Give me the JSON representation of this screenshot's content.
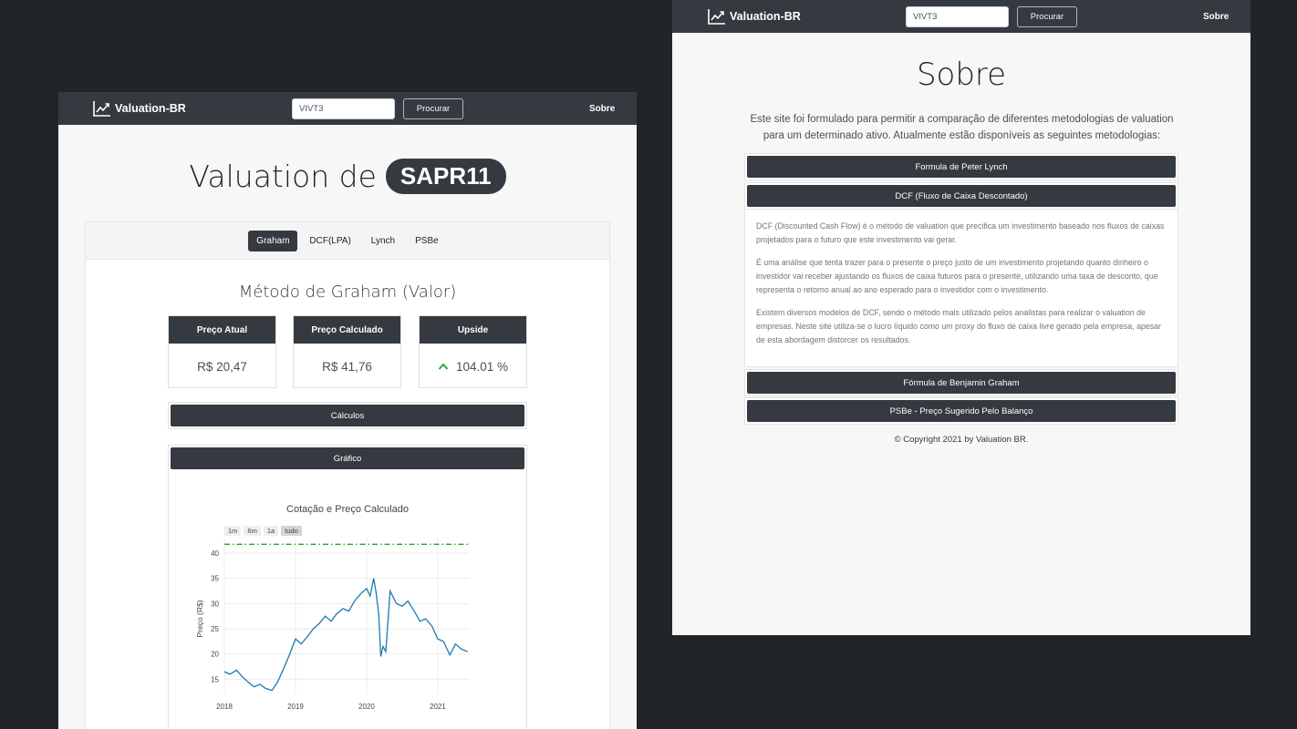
{
  "left": {
    "nav": {
      "brand": "Valuation-BR",
      "search_value": "VIVT3",
      "search_btn": "Procurar",
      "about_link": "Sobre"
    },
    "heading_prefix": "Valuation de",
    "ticker": "SAPR11",
    "tabs": [
      {
        "label": "Graham",
        "active": true
      },
      {
        "label": "DCF(LPA)",
        "active": false
      },
      {
        "label": "Lynch",
        "active": false
      },
      {
        "label": "PSBe",
        "active": false
      }
    ],
    "method_title": "Método de Graham (Valor)",
    "metrics": [
      {
        "label": "Preço Atual",
        "value": "R$ 20,47"
      },
      {
        "label": "Preço Calculado",
        "value": "R$ 41,76"
      },
      {
        "label": "Upside",
        "value": "104.01 %"
      }
    ],
    "calc_btn": "Cálculos",
    "chart_btn": "Gráfico",
    "range_buttons": [
      "1m",
      "6m",
      "1a",
      "tudo"
    ]
  },
  "chart_data": {
    "type": "line",
    "title": "Cotação e Preço Calculado",
    "xlabel": "",
    "ylabel": "Preço (R$)",
    "x_ticks": [
      "2018",
      "2019",
      "2020",
      "2021"
    ],
    "y_ticks": [
      15,
      20,
      25,
      30,
      35,
      40
    ],
    "ylim": [
      12,
      42
    ],
    "xlim": [
      2018.0,
      2021.45
    ],
    "grid": true,
    "series": [
      {
        "color": "#1f77b4",
        "style": "solid",
        "x": [
          2018.0,
          2018.08,
          2018.17,
          2018.25,
          2018.33,
          2018.42,
          2018.5,
          2018.58,
          2018.67,
          2018.75,
          2018.83,
          2018.92,
          2019.0,
          2019.08,
          2019.17,
          2019.25,
          2019.33,
          2019.42,
          2019.5,
          2019.58,
          2019.67,
          2019.75,
          2019.83,
          2019.92,
          2020.0,
          2020.05,
          2020.1,
          2020.13,
          2020.17,
          2020.2,
          2020.23,
          2020.27,
          2020.33,
          2020.42,
          2020.5,
          2020.58,
          2020.67,
          2020.75,
          2020.83,
          2020.92,
          2021.0,
          2021.08,
          2021.17,
          2021.25,
          2021.33,
          2021.42
        ],
        "y": [
          16.5,
          16.0,
          16.8,
          15.5,
          14.5,
          13.5,
          14.0,
          13.2,
          12.8,
          14.5,
          17.0,
          20.0,
          23.0,
          22.0,
          23.5,
          25.0,
          26.0,
          27.5,
          26.5,
          28.0,
          29.0,
          28.5,
          30.5,
          32.0,
          33.0,
          31.5,
          35.0,
          32.5,
          28.0,
          19.5,
          21.5,
          20.5,
          32.5,
          30.0,
          29.5,
          30.5,
          28.5,
          26.5,
          27.0,
          25.5,
          23.0,
          22.5,
          19.8,
          22.0,
          21.0,
          20.47
        ]
      },
      {
        "color": "#2ca02c",
        "style": "dashdot",
        "x": [
          2018.0,
          2021.45
        ],
        "y": [
          41.76,
          41.76
        ]
      }
    ]
  },
  "right": {
    "nav": {
      "brand": "Valuation-BR",
      "search_value": "VIVT3",
      "search_btn": "Procurar",
      "about_link": "Sobre"
    },
    "title": "Sobre",
    "intro": "Este site foi formulado para permitir a comparação de diferentes metodologias de valuation para um determinado ativo. Atualmente estão disponíveis as seguintes metodologias:",
    "accordion": {
      "lynch": "Formula de Peter Lynch",
      "dcf": "DCF (Fluxo de Caixa Descontado)",
      "dcf_p1": "DCF (Discounted Cash Flow) é o método de valuation que precifica um investimento baseado nos fluxos de caixas projetados para o futuro que este investimento vai gerar.",
      "dcf_p2": "É uma análise que tenta trazer para o presente o preço justo de um investimento projetando quanto dinheiro o investidor vai receber ajustando os fluxos de caixa futuros para o presente, utilizando uma taxa de desconto, que representa o retorno anual ao ano esperado para o investidor com o investimento.",
      "dcf_p3": "Existem diversos modelos de DCF, sendo o método mais utilizado pelos analistas para realizar o valuation de empresas. Neste site utiliza-se o lucro líquido como um proxy do fluxo de caixa livre gerado pela empresa, apesar de esta abordagem distorcer os resultados.",
      "graham": "Fórmula de Benjamin Graham",
      "psbe": "PSBe - Preço Sugerido Pelo Balanço"
    },
    "footer": "© Copyright 2021 by Valuation BR."
  }
}
